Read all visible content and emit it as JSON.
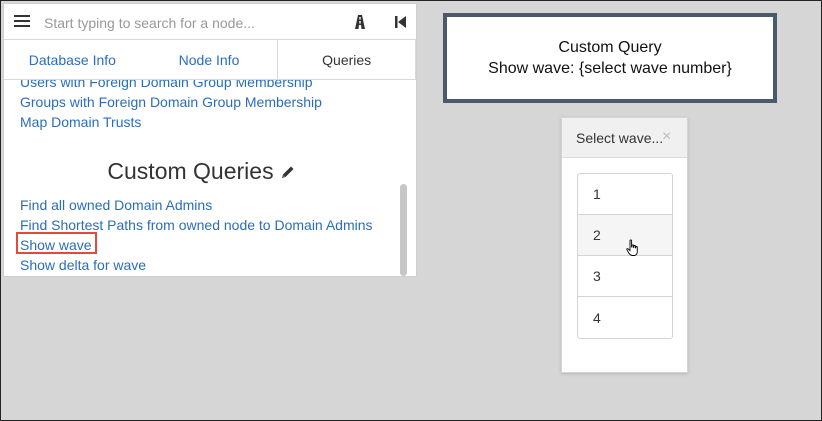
{
  "search": {
    "placeholder": "Start typing to search for a node..."
  },
  "icons": {
    "menu": "hamburger-menu-icon",
    "pathfinding": "road-icon",
    "collapse": "step-backward-icon",
    "edit": "pencil-icon",
    "close": "close-icon",
    "cursor": "hand-pointer-icon"
  },
  "tabs": [
    {
      "label": "Database Info",
      "active": false
    },
    {
      "label": "Node Info",
      "active": false
    },
    {
      "label": "Queries",
      "active": true
    }
  ],
  "queries": {
    "prebuilt": [
      "Users with Foreign Domain Group Membership",
      "Groups with Foreign Domain Group Membership",
      "Map Domain Trusts"
    ],
    "custom_title": "Custom Queries",
    "custom": [
      "Find all owned Domain Admins",
      "Find Shortest Paths from owned node to Domain Admins",
      "Show wave",
      "Show delta for wave"
    ],
    "highlighted": "Show wave"
  },
  "tooltip": {
    "line1": "Custom Query",
    "line2": "Show wave: {select wave number}"
  },
  "modal": {
    "title": "Select wave...",
    "close": "×",
    "options": [
      "1",
      "2",
      "3",
      "4"
    ],
    "hovered": "2"
  },
  "colors": {
    "link": "#2a6ebb",
    "highlight_box": "#e04b3c",
    "tooltip_border": "#4a5a6c",
    "background": "#d6d6d6"
  }
}
